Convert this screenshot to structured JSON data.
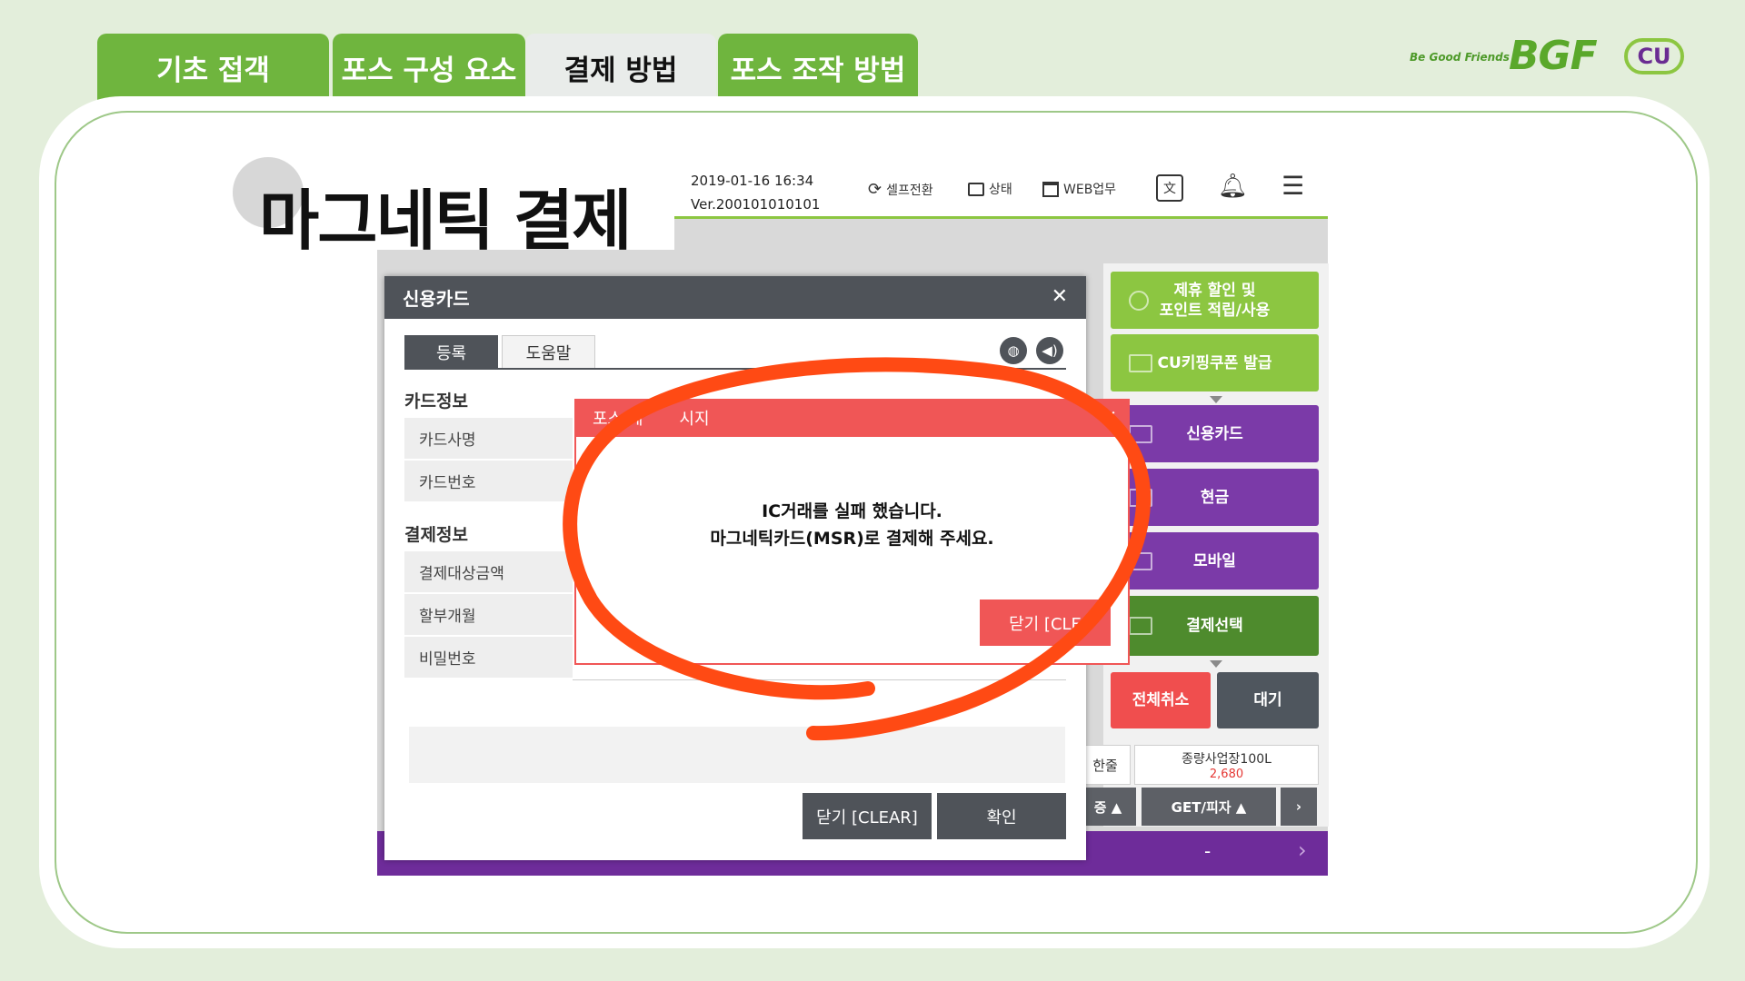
{
  "tabs": [
    {
      "label": "기초 접객"
    },
    {
      "label": "포스 구성 요소"
    },
    {
      "label": "결제 방법"
    },
    {
      "label": "포스 조작 방법"
    }
  ],
  "branding": {
    "tagline": "Be Good Friends",
    "bgf": "BGF",
    "cu": "CU",
    "accent": "#6fb53e"
  },
  "page_title": "마그네틱 결제",
  "pos": {
    "datetime": "2019-01-16 16:34",
    "version": "Ver.200101010101",
    "toolbar": {
      "self_switch": "셀프전환",
      "status": "상태",
      "web": "WEB업무"
    },
    "side_buttons": {
      "partner": "제휴 할인 및\n포인트 적립/사용",
      "coupon": "CU키핑쿠폰 발급",
      "credit": "신용카드",
      "cash": "현금",
      "mobile": "모바일",
      "select": "결제선택",
      "cancel_all": "전체취소",
      "wait": "대기"
    },
    "lower": {
      "cell1": "한줄",
      "cell2_title": "종량사업장100L",
      "cell2_value": "2,680",
      "btn1": "증 ▲",
      "btn2": "GET/피자 ▲",
      "strip_label": "-"
    }
  },
  "card_dialog": {
    "title": "신용카드",
    "tabs": {
      "register": "등록",
      "help": "도움말"
    },
    "card_section": "카드정보",
    "card_rows": [
      "카드사명",
      "카드번호"
    ],
    "pay_section": "결제정보",
    "pay_rows": [
      "결제대상금액",
      "할부개월",
      "비밀번호"
    ],
    "btn_close": "닫기 [CLEAR]",
    "btn_ok": "확인"
  },
  "error_dialog": {
    "title": "포스 에",
    "title_end": "시지",
    "line1": "IC거래를 실패 했습니다.",
    "line2": "마그네틱카드(MSR)로 결제해 주세요.",
    "button": "닫기 [CLE"
  },
  "annotation_color": "#ff4a14"
}
